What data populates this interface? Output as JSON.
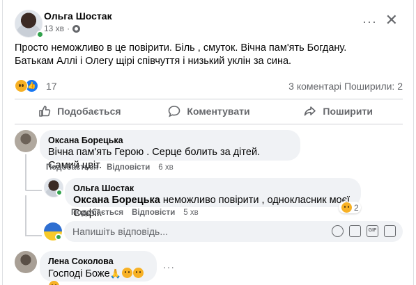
{
  "post": {
    "author": "Ольга Шостак",
    "time": "13 хв",
    "text_line1": "Просто неможливо в це повірити. Біль , смуток. Вічна пам'ять Богдану.",
    "text_line2": "Батькам Аллі і Олегу щірі співчуття і низький уклін за сина.",
    "reaction_count": "17",
    "comments_count": "3 коментарі",
    "shares_count": "Поширили: 2"
  },
  "actions": {
    "like": "Подобається",
    "comment": "Коментувати",
    "share": "Поширити"
  },
  "comment1": {
    "author": "Оксана Борецька",
    "text": "Вічна пам'ять Герою . Серце болить за дітей. Самий цвіт.",
    "like": "Подобається",
    "reply": "Відповісти",
    "time": "6 хв"
  },
  "reply1": {
    "author": "Ольга Шостак",
    "mention": "Оксана Борецька",
    "text": " неможливо повірити , однокласник моєї Софії.",
    "like": "Подобається",
    "reply": "Відповісти",
    "time": "5 хв",
    "reaction_count": "2"
  },
  "reply_input": {
    "placeholder": "Напишіть відповідь..."
  },
  "comment2": {
    "author": "Лена Соколова",
    "text": "Господі Боже"
  },
  "colors": {
    "accent": "#1877f2",
    "online": "#31a24c",
    "secondary_text": "#65676b",
    "bubble_bg": "#f0f2f5"
  },
  "icons": [
    "more-icon",
    "close-icon",
    "globe-icon",
    "like-icon",
    "comment-icon",
    "share-icon",
    "sad-reaction-icon",
    "like-reaction-icon",
    "emoji-icon",
    "camera-icon",
    "gif-icon",
    "sticker-icon"
  ]
}
